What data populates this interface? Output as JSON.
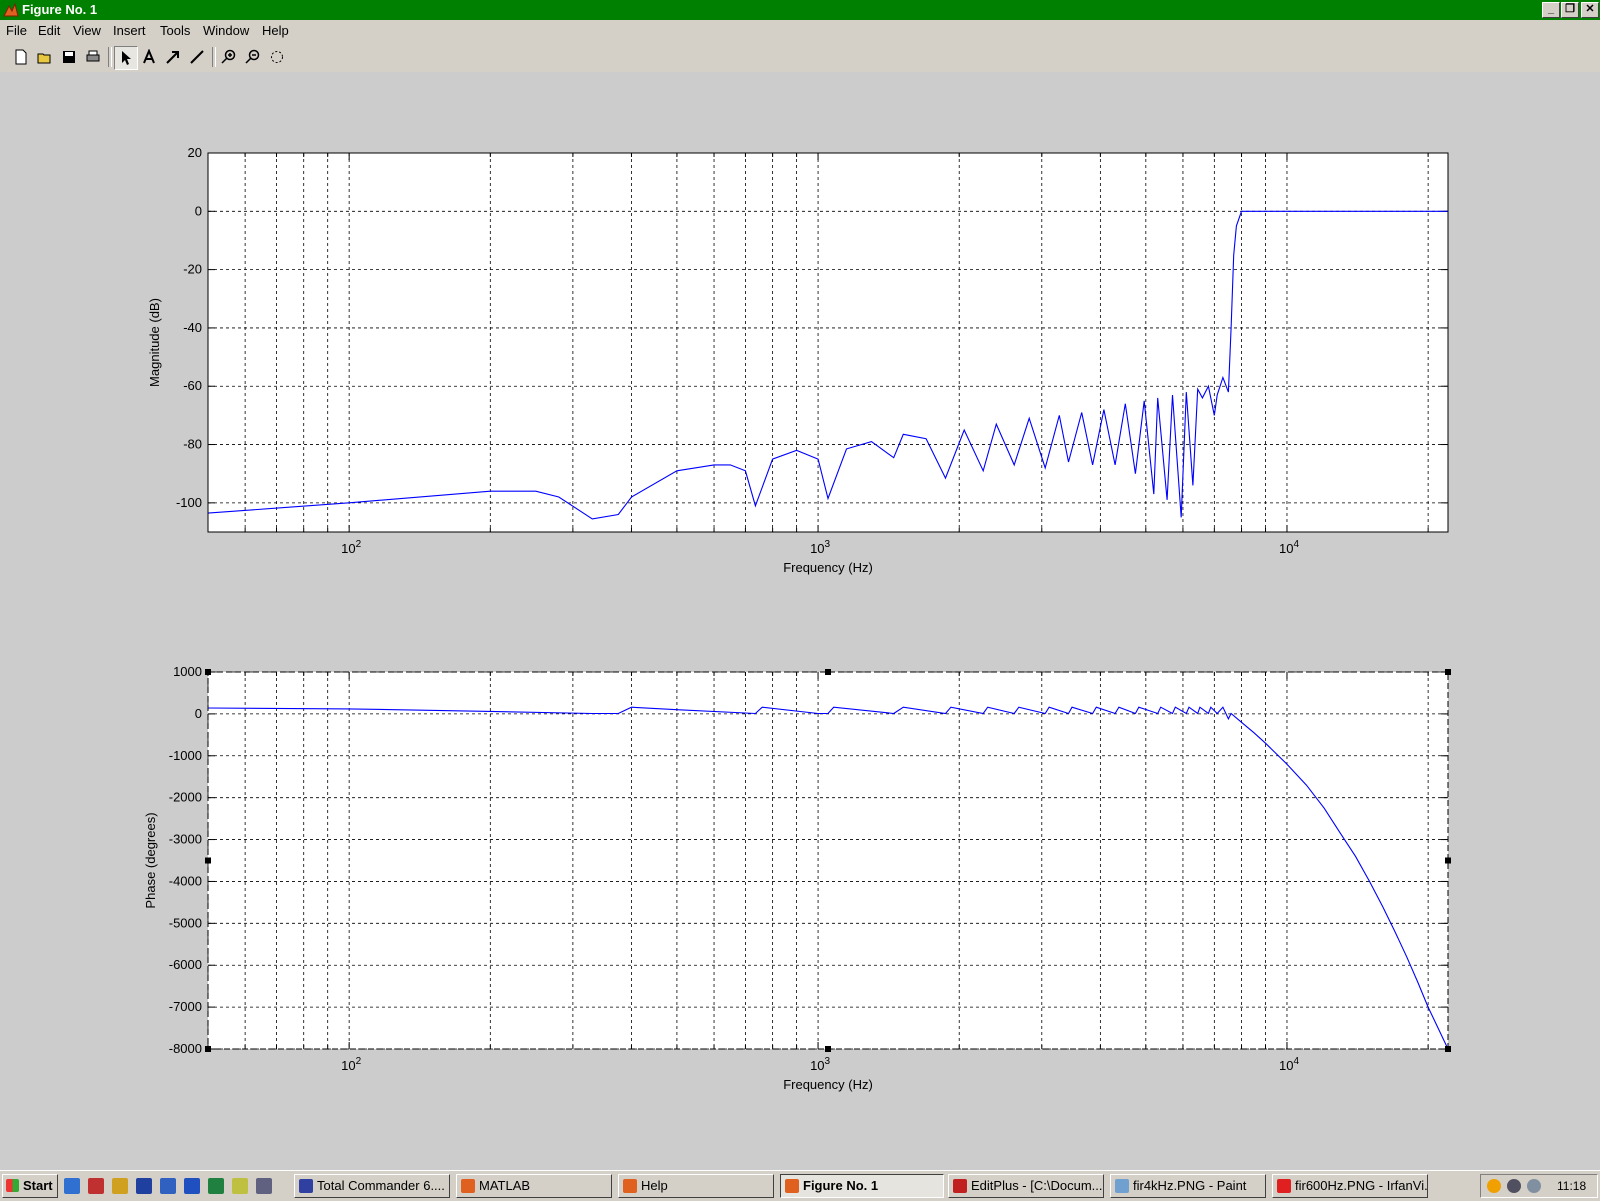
{
  "window": {
    "title": "Figure No. 1",
    "controls": [
      "minimize",
      "restore",
      "close"
    ]
  },
  "menu": {
    "items": [
      "File",
      "Edit",
      "View",
      "Insert",
      "Tools",
      "Window",
      "Help"
    ]
  },
  "toolbar": {
    "buttons": [
      "new-figure-icon",
      "open-file-icon",
      "save-icon",
      "print-icon",
      "select-arrow-icon",
      "insert-text-icon",
      "insert-arrow-icon",
      "insert-line-icon",
      "zoom-in-icon",
      "zoom-out-icon",
      "rotate-3d-icon"
    ]
  },
  "chart_data": [
    {
      "type": "line",
      "xlabel": "Frequency (Hz)",
      "ylabel": "Magnitude (dB)",
      "xscale": "log",
      "xlim": [
        50,
        22050
      ],
      "ylim": [
        -110,
        20
      ],
      "yticks": [
        20,
        0,
        -20,
        -40,
        -60,
        -80,
        -100
      ],
      "xticks": [
        100,
        1000,
        10000
      ],
      "xtick_labels": [
        {
          "base": "10",
          "exp": "2"
        },
        {
          "base": "10",
          "exp": "3"
        },
        {
          "base": "10",
          "exp": "4"
        }
      ],
      "grid": true,
      "color": "#0000ff",
      "series": [
        {
          "x": [
            50,
            100,
            200,
            250,
            280,
            330,
            375,
            400,
            500,
            600,
            650,
            700,
            735,
            800,
            900,
            1000,
            1050,
            1150,
            1300,
            1450,
            1520,
            1700,
            1870,
            2050,
            2250,
            2400,
            2620,
            2820,
            3050,
            3270,
            3420,
            3650,
            3850,
            4070,
            4300,
            4520,
            4750,
            4960,
            5200,
            5300,
            5550,
            5700,
            5950,
            6100,
            6300,
            6450,
            6600,
            6800,
            7000,
            7100,
            7300,
            7500,
            7600,
            7700,
            7800,
            8000,
            8400,
            9000,
            12000,
            22050
          ],
          "y": [
            -103.5,
            -100,
            -96,
            -96,
            -98,
            -105.5,
            -104,
            -98,
            -89,
            -87,
            -87,
            -89,
            -101,
            -85,
            -82,
            -85,
            -98.5,
            -81.5,
            -79,
            -84.5,
            -76.5,
            -78,
            -91.5,
            -75,
            -89,
            -73,
            -87,
            -71,
            -88,
            -70,
            -86,
            -69,
            -87,
            -68,
            -87,
            -66,
            -90,
            -65,
            -97,
            -64,
            -99,
            -63,
            -105,
            -62,
            -94,
            -61,
            -64,
            -60,
            -70,
            -63,
            -57,
            -62,
            -40,
            -15,
            -5,
            0,
            0,
            0,
            0,
            0
          ]
        }
      ]
    },
    {
      "type": "line",
      "xlabel": "Frequency (Hz)",
      "ylabel": "Phase (degrees)",
      "xscale": "log",
      "xlim": [
        50,
        22050
      ],
      "ylim": [
        -8000,
        1000
      ],
      "yticks": [
        1000,
        0,
        -1000,
        -2000,
        -3000,
        -4000,
        -5000,
        -6000,
        -7000,
        -8000
      ],
      "xticks": [
        100,
        1000,
        10000
      ],
      "xtick_labels": [
        {
          "base": "10",
          "exp": "2"
        },
        {
          "base": "10",
          "exp": "3"
        },
        {
          "base": "10",
          "exp": "4"
        }
      ],
      "grid": true,
      "color": "#0000ff",
      "series": [
        {
          "x": [
            50,
            100,
            200,
            330,
            375,
            400,
            500,
            735,
            760,
            1000,
            1050,
            1080,
            1450,
            1520,
            1870,
            1920,
            2250,
            2300,
            2620,
            2680,
            3050,
            3110,
            3420,
            3480,
            3850,
            3920,
            4300,
            4380,
            4750,
            4830,
            5300,
            5380,
            5700,
            5780,
            6100,
            6180,
            6450,
            6520,
            6800,
            6880,
            7100,
            7300,
            7500,
            7600,
            8000,
            8500,
            9000,
            10000,
            11000,
            12000,
            13000,
            14000,
            15000,
            16000,
            17000,
            18000,
            19000,
            20000,
            21000,
            22050
          ],
          "y": [
            140,
            120,
            60,
            10,
            10,
            160,
            100,
            10,
            160,
            10,
            10,
            160,
            10,
            160,
            10,
            160,
            10,
            160,
            10,
            160,
            10,
            160,
            10,
            160,
            10,
            160,
            10,
            160,
            10,
            160,
            10,
            160,
            10,
            160,
            10,
            160,
            10,
            160,
            10,
            160,
            10,
            160,
            -120,
            10,
            -200,
            -450,
            -700,
            -1200,
            -1700,
            -2250,
            -2850,
            -3400,
            -4000,
            -4600,
            -5200,
            -5800,
            -6400,
            -7000,
            -7500,
            -8000
          ]
        }
      ]
    }
  ],
  "taskbar": {
    "start_label": "Start",
    "quick_launch": [
      "ie-icon",
      "app-icon",
      "tool-icon",
      "disk-icon",
      "vs-icon",
      "word-icon",
      "excel-icon",
      "media-icon",
      "calc-icon"
    ],
    "tasks": [
      {
        "label": "Total Commander 6....",
        "icon": "floppy-icon",
        "active": false
      },
      {
        "label": "MATLAB",
        "icon": "matlab-icon",
        "active": false
      },
      {
        "label": "Help",
        "icon": "matlab-icon",
        "active": false
      },
      {
        "label": "Figure No. 1",
        "icon": "matlab-icon",
        "active": true
      },
      {
        "label": "EditPlus - [C:\\Docum...",
        "icon": "editplus-icon",
        "active": false
      },
      {
        "label": "fir4kHz.PNG - Paint",
        "icon": "paint-icon",
        "active": false
      },
      {
        "label": "fir600Hz.PNG - IrfanVi...",
        "icon": "irfanview-icon",
        "active": false
      }
    ],
    "tray_icons": [
      "sun-icon",
      "network-icon",
      "volume-icon"
    ],
    "clock": "11:18"
  }
}
